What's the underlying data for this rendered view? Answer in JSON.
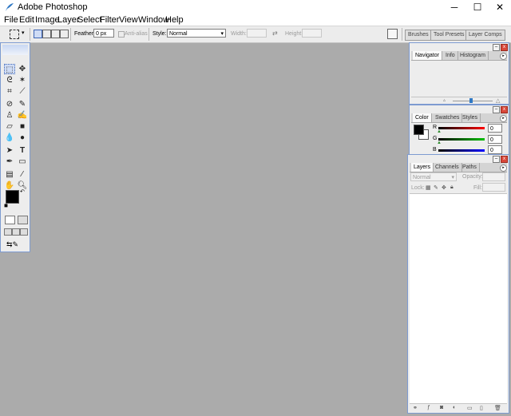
{
  "window": {
    "title": "Adobe Photoshop",
    "minimize": "─",
    "maximize": "☐",
    "close": "✕"
  },
  "menu": [
    "File",
    "Edit",
    "Image",
    "Layer",
    "Select",
    "Filter",
    "View",
    "Window",
    "Help"
  ],
  "options": {
    "feather_label": "Feather:",
    "feather_value": "0 px",
    "antialias_label": "Anti-alias",
    "style_label": "Style:",
    "style_value": "Normal",
    "width_label": "Width:",
    "height_label": "Height:",
    "wells": [
      "Brushes",
      "Tool Presets",
      "Layer Comps"
    ]
  },
  "navigator": {
    "tabs": [
      "Navigator",
      "Info",
      "Histogram"
    ]
  },
  "color": {
    "tabs": [
      "Color",
      "Swatches",
      "Styles"
    ],
    "channels": [
      {
        "label": "R",
        "value": "0",
        "gradient": "#ff0000"
      },
      {
        "label": "G",
        "value": "0",
        "gradient": "#00c000"
      },
      {
        "label": "B",
        "value": "0",
        "gradient": "#0000ff"
      }
    ]
  },
  "layers": {
    "tabs": [
      "Layers",
      "Channels",
      "Paths"
    ],
    "blend_mode": "Normal",
    "opacity_label": "Opacity:",
    "lock_label": "Lock:",
    "fill_label": "Fill:"
  },
  "colors": {
    "accent": "#7d9bd1",
    "workspace": "#ababab",
    "panel": "#ededed"
  }
}
